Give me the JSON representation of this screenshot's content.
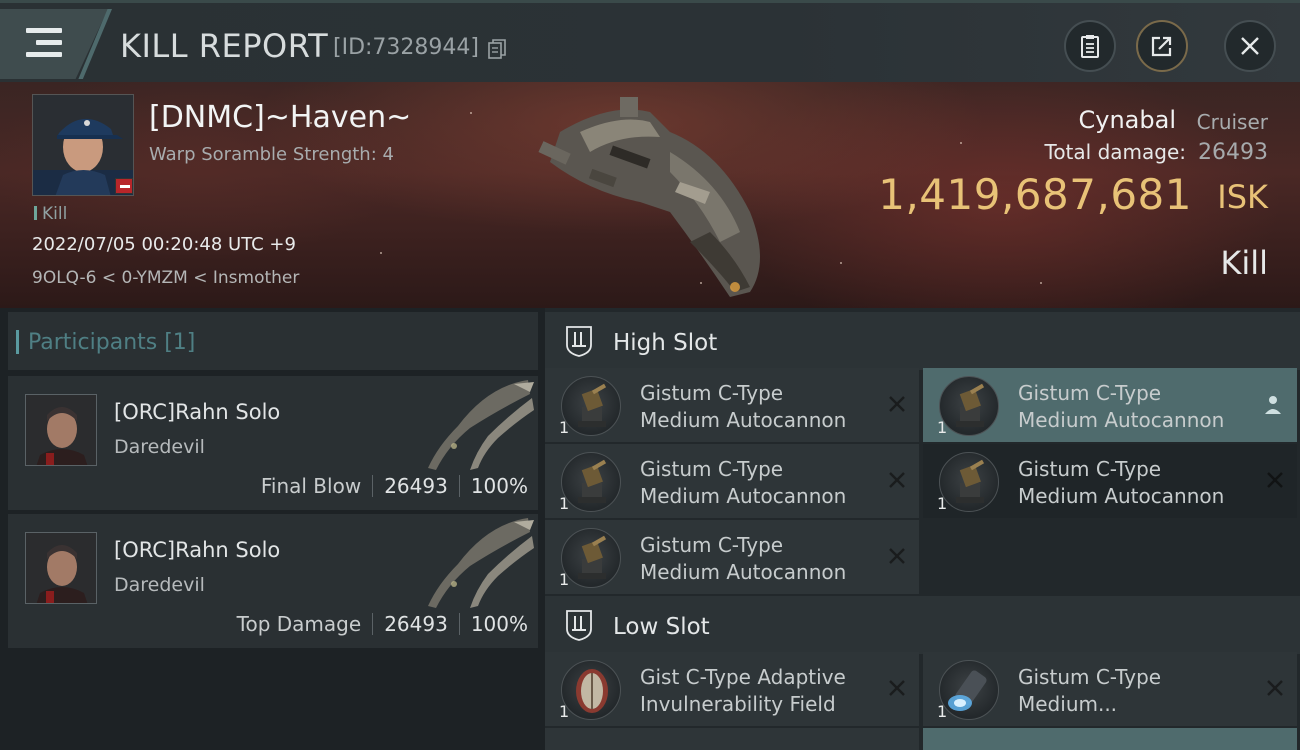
{
  "header": {
    "title": "KILL REPORT",
    "report_id": "[ID:7328944]"
  },
  "victim": {
    "name": "[DNMC]~Haven~",
    "subtitle": "Warp Soramble Strength: 4",
    "tag": "Kill",
    "datetime": "2022/07/05 00:20:48 UTC +9",
    "location": "9OLQ-6 < 0-YMZM < Insmother"
  },
  "ship": {
    "name": "Cynabal",
    "class": "Cruiser",
    "damage_label": "Total damage:",
    "damage_value": "26493",
    "isk_value": "1,419,687,681",
    "isk_unit": "ISK",
    "result": "Kill"
  },
  "participants": {
    "title": "Participants [1]",
    "items": [
      {
        "name": "[ORC]Rahn Solo",
        "ship": "Daredevil",
        "role": "Final Blow",
        "damage": "26493",
        "percent": "100%"
      },
      {
        "name": "[ORC]Rahn Solo",
        "ship": "Daredevil",
        "role": "Top Damage",
        "damage": "26493",
        "percent": "100%"
      }
    ]
  },
  "fitting": {
    "high_slot": {
      "title": "High Slot",
      "modules": [
        {
          "line1": "Gistum C-Type",
          "line2": "Medium Autocannon",
          "qty": "1",
          "icon": "autocannon-icon"
        },
        {
          "line1": "Gistum C-Type",
          "line2": "Medium Autocannon",
          "qty": "1",
          "icon": "autocannon-icon"
        },
        {
          "line1": "Gistum C-Type",
          "line2": "Medium Autocannon",
          "qty": "1",
          "icon": "autocannon-icon"
        },
        {
          "line1": "Gistum C-Type",
          "line2": "Medium Autocannon",
          "qty": "1",
          "icon": "autocannon-icon"
        },
        {
          "line1": "Gistum C-Type",
          "line2": "Medium Autocannon",
          "qty": "1",
          "icon": "autocannon-icon"
        }
      ]
    },
    "low_slot": {
      "title": "Low Slot",
      "modules": [
        {
          "line1": "Gist C-Type Adaptive",
          "line2": "Invulnerability Field",
          "qty": "1",
          "icon": "shield-hardener-icon"
        },
        {
          "line1": "Gistum C-Type",
          "line2": "Medium...",
          "qty": "1",
          "icon": "shield-booster-icon"
        }
      ]
    }
  },
  "colors": {
    "accent_teal": "#5a9aa0",
    "isk_gold": "#e8c277",
    "highlight_row": "#4f6b6d",
    "negative_standing": "#b8262a"
  }
}
